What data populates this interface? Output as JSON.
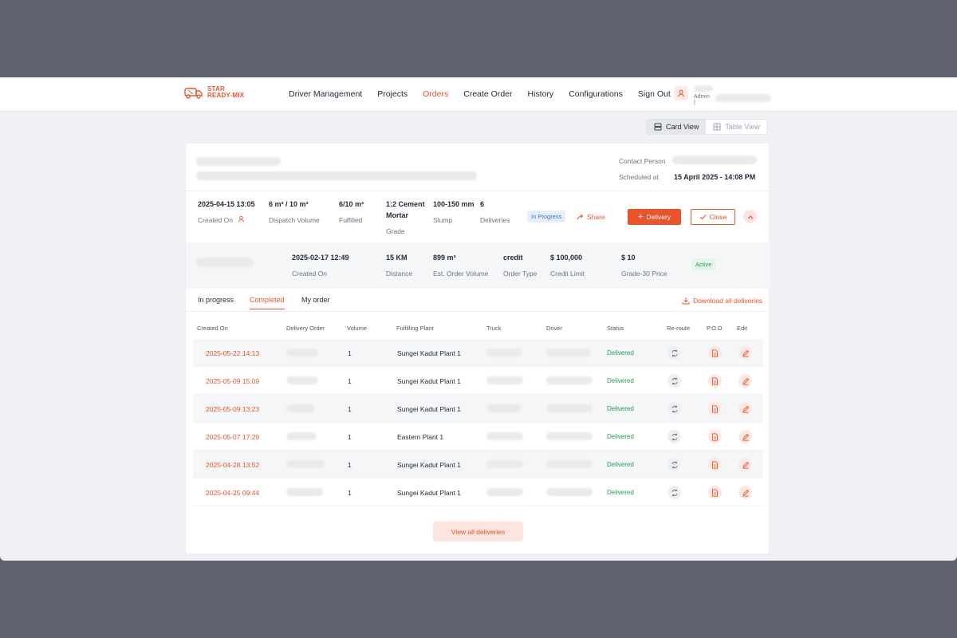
{
  "brand": {
    "line1": "STAR",
    "line2": "READY-MIX"
  },
  "nav": [
    "Driver Management",
    "Projects",
    "Orders",
    "Create Order",
    "History",
    "Configurations",
    "Sign Out"
  ],
  "nav_active": "Orders",
  "user": {
    "role": "Admin |"
  },
  "view_toggle": {
    "card": "Card View",
    "table": "Table View",
    "selected": "Card View"
  },
  "order_header": {
    "contact_label": "Contact Person",
    "scheduled_label": "Scheduled at",
    "scheduled_value": "15 April 2025 - 14:08 PM"
  },
  "order_summary": {
    "created_on": {
      "value": "2025-04-15 13:05",
      "label": "Created On"
    },
    "dispatch_volume": {
      "value": "6 m³ / 10 m³",
      "label": "Dispatch Volume"
    },
    "fulfilled": {
      "value": "6/10 m³",
      "label": "Fulfilled"
    },
    "grade": {
      "value_line1": "1:2 Cement",
      "value_line2": "Mortar",
      "label": "Grade"
    },
    "slump": {
      "value": "100-150 mm",
      "label": "Slump"
    },
    "deliveries": {
      "value": "6",
      "label": "Deliveries"
    },
    "status": "In Progress",
    "share_label": "Share",
    "delivery_button": "Delivery",
    "close_button": "Close"
  },
  "project_info": {
    "created_on": {
      "value": "2025-02-17 12:49",
      "label": "Created On"
    },
    "distance": {
      "value": "15 KM",
      "label": "Distance"
    },
    "est_volume": {
      "value": "899 m³",
      "label": "Est. Order Volume"
    },
    "order_type": {
      "value": "credit",
      "label": "Order Type"
    },
    "credit_limit": {
      "value": "$ 100,000",
      "label": "Credit Limit"
    },
    "grade_price": {
      "value": "$ 10",
      "label": "Grade-30 Price"
    },
    "status": "Active"
  },
  "tabs": [
    "In progress",
    "Completed",
    "My order"
  ],
  "active_tab": "Completed",
  "download_label": "Download all deliveries",
  "table": {
    "headers": [
      "Created On",
      "Delivery Order",
      "Volume",
      "Fulfilling Plant",
      "Truck",
      "Driver",
      "Status",
      "Re-route",
      "P.O.D",
      "Edit"
    ],
    "rows": [
      {
        "created": "2025-05-22 14:13",
        "volume": "1",
        "plant": "Sungei Kadut Plant 1",
        "status": "Delivered"
      },
      {
        "created": "2025-05-09 15:09",
        "volume": "1",
        "plant": "Sungei Kadut Plant 1",
        "status": "Delivered"
      },
      {
        "created": "2025-05-09 13:23",
        "volume": "1",
        "plant": "Sungei Kadut Plant 1",
        "status": "Delivered"
      },
      {
        "created": "2025-05-07 17:29",
        "volume": "1",
        "plant": "Eastern Plant 1",
        "status": "Delivered"
      },
      {
        "created": "2025-04-28 13:52",
        "volume": "1",
        "plant": "Sungei Kadut Plant 1",
        "status": "Delivered"
      },
      {
        "created": "2025-04-25 09:44",
        "volume": "1",
        "plant": "Sungei Kadut Plant 1",
        "status": "Delivered"
      }
    ]
  },
  "view_all_label": "View all deliveries",
  "colors": {
    "accent": "#e8542c",
    "success": "#22a052",
    "info": "#3b6fd8"
  }
}
